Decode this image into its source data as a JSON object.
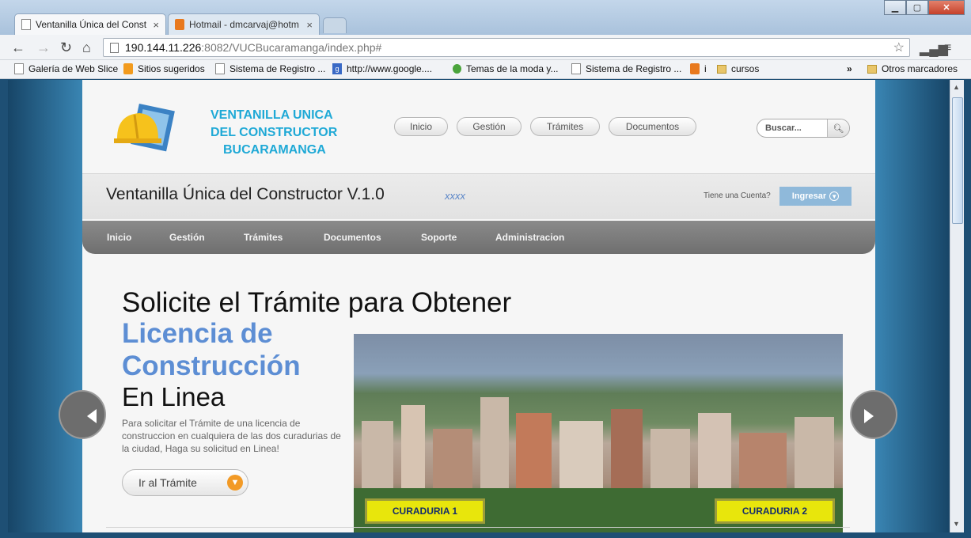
{
  "browser": {
    "tabs": [
      {
        "label": "Ventanilla Única del Const",
        "active": true
      },
      {
        "label": "Hotmail - dmcarvaj@hotm",
        "active": false
      }
    ],
    "tab_close": "×",
    "url_host": "190.144.11.226",
    "url_path": ":8082/VUCBucaramanga/index.php#",
    "bookmarks": [
      {
        "label": "Galería de Web Slice",
        "icon": "page-icon"
      },
      {
        "label": "Sitios sugeridos",
        "icon": "orange-pin-icon"
      },
      {
        "label": "Sistema de Registro ...",
        "icon": "page-icon"
      },
      {
        "label": "http://www.google....",
        "icon": "google-icon"
      },
      {
        "label": "Temas de la moda y...",
        "icon": "green-icon"
      },
      {
        "label": "Sistema de Registro ...",
        "icon": "page-icon"
      },
      {
        "label": "i",
        "icon": "mail-icon"
      },
      {
        "label": "cursos",
        "icon": "folder-icon"
      }
    ],
    "more_bookmarks": "»",
    "other_bookmarks": "Otros marcadores"
  },
  "site": {
    "logo_lines": [
      "VENTANILLA UNICA",
      "DEL CONSTRUCTOR",
      "BUCARAMANGA"
    ],
    "top_nav": [
      "Inicio",
      "Gestión",
      "Trámites",
      "Documentos"
    ],
    "search_placeholder": "Buscar...",
    "app_title": "Ventanilla Única del Constructor V.1.0",
    "app_sub": "xxxx",
    "account_question": "Tiene una Cuenta?",
    "login_label": "Ingresar",
    "main_nav": [
      "Inicio",
      "Gestión",
      "Trámites",
      "Documentos",
      "Soporte",
      "Administracion"
    ],
    "hero": {
      "line1": "Solicite el Trámite para Obtener",
      "blue1": "Licencia de",
      "blue2": "Construcción",
      "line3": "En Linea",
      "description": "Para solicitar el Trámite de una licencia de construccion en cualquiera de las dos curadurias de la ciudad, Haga su solicitud en Linea!",
      "cta_label": "Ir al Trámite"
    },
    "curaduria_1": "CURADURIA 1",
    "curaduria_2": "CURADURIA 2"
  },
  "colors": {
    "accent_blue": "#5d8ed4",
    "logo_cyan": "#1fa9d6",
    "cta_orange": "#f29a26",
    "curaduria_yellow": "#e8e60c"
  }
}
